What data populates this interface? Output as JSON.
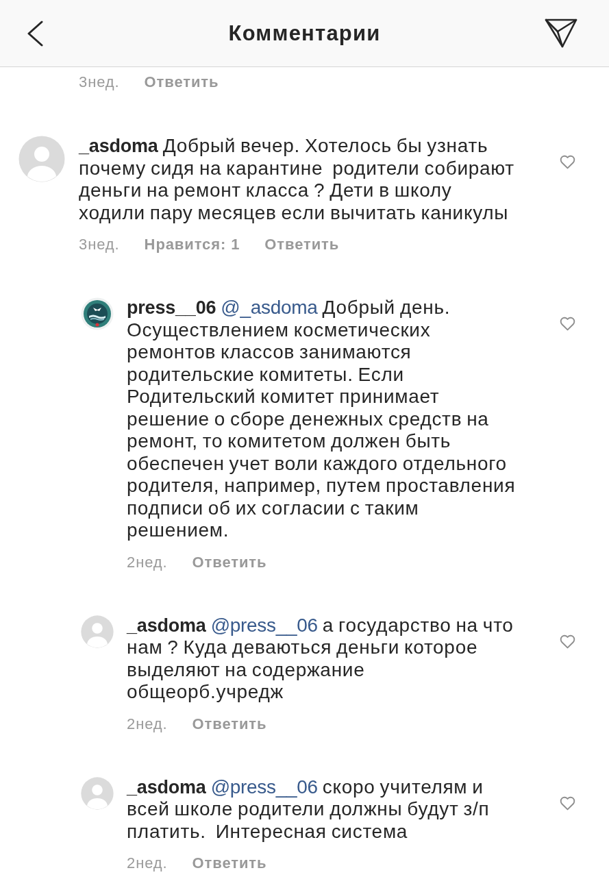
{
  "header": {
    "title": "Комментарии"
  },
  "previous_footer": {
    "time": "3нед.",
    "reply": "Ответить"
  },
  "comments": [
    {
      "avatar": {
        "kind": "default"
      },
      "username": "_asdoma",
      "text": "Добрый вечер. Хотелось бы узнать почему сидя на карантине  родители собирают деньги на ремонт класса ? Дети в школу ходили пару месяцев если вычитать каникулы",
      "time": "3нед.",
      "likes": "Нравится: 1",
      "reply": "Ответить",
      "liked": false,
      "replies": [
        {
          "avatar": {
            "kind": "emblem"
          },
          "username": "press__06",
          "mention": "@_asdoma",
          "text": "Добрый день. Осуществлением косметических ремонтов классов занимаются родительские комитеты. Если Родительский комитет принимает решение о сборе денежных средств на ремонт, то комитетом должен быть обеспечен учет воли каждого отдельного родителя, например, путем проставления подписи об их согласии с таким решением.",
          "time": "2нед.",
          "reply": "Ответить",
          "liked": false
        },
        {
          "avatar": {
            "kind": "default"
          },
          "username": "_asdoma",
          "mention": "@press__06",
          "text": "а государство на что нам ? Куда деваються деньги которое выделяют на содержание общеорб.учредж",
          "time": "2нед.",
          "reply": "Ответить",
          "liked": false
        },
        {
          "avatar": {
            "kind": "default"
          },
          "username": "_asdoma",
          "mention": "@press__06",
          "text": "скоро учителям и всей школе родители должны будут з/п платить.  Интересная система",
          "time": "2нед.",
          "reply": "Ответить",
          "liked": false
        }
      ]
    }
  ]
}
